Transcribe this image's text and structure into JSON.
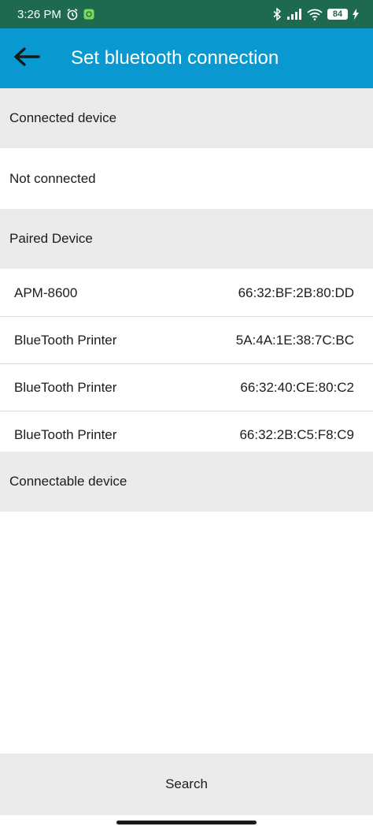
{
  "status_bar": {
    "time": "3:26 PM",
    "battery": "84",
    "icons": [
      "alarm-icon",
      "app-notification-icon",
      "bluetooth-icon",
      "signal-icon",
      "wifi-icon",
      "battery-icon",
      "charging-icon"
    ]
  },
  "app_bar": {
    "back_icon": "arrow-left-icon",
    "title": "Set bluetooth connection"
  },
  "sections": {
    "connected_header": "Connected device",
    "connected_status": "Not connected",
    "paired_header": "Paired Device",
    "connectable_header": "Connectable device"
  },
  "paired_devices": [
    {
      "name": "APM-8600",
      "address": "66:32:BF:2B:80:DD"
    },
    {
      "name": "BlueTooth Printer",
      "address": "5A:4A:1E:38:7C:BC"
    },
    {
      "name": "BlueTooth Printer",
      "address": "66:32:40:CE:80:C2"
    },
    {
      "name": "BlueTooth Printer",
      "address": "66:32:2B:C5:F8:C9"
    }
  ],
  "search_button": "Search",
  "colors": {
    "status_bar": "#1d6a50",
    "app_bar": "#0a98d0",
    "section_bg": "#ebebeb"
  }
}
